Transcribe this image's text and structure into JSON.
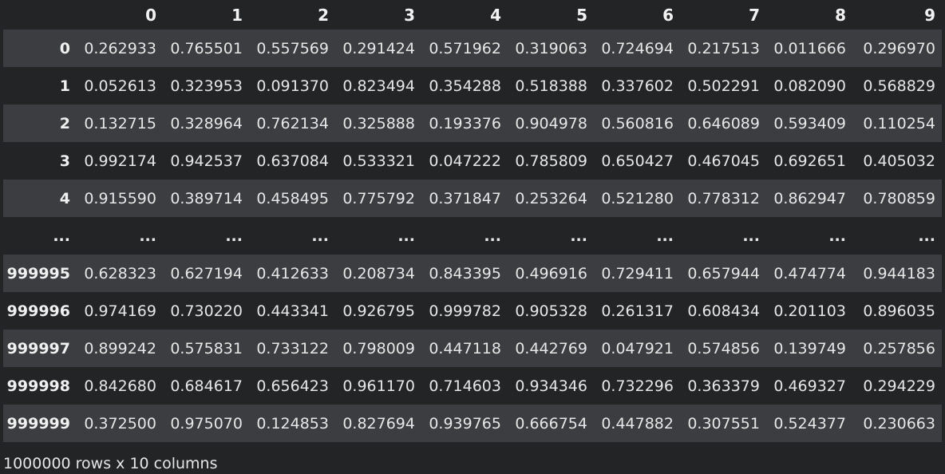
{
  "table": {
    "columns": [
      "0",
      "1",
      "2",
      "3",
      "4",
      "5",
      "6",
      "7",
      "8",
      "9"
    ],
    "rows": [
      {
        "index": "0",
        "cells": [
          "0.262933",
          "0.765501",
          "0.557569",
          "0.291424",
          "0.571962",
          "0.319063",
          "0.724694",
          "0.217513",
          "0.011666",
          "0.296970"
        ]
      },
      {
        "index": "1",
        "cells": [
          "0.052613",
          "0.323953",
          "0.091370",
          "0.823494",
          "0.354288",
          "0.518388",
          "0.337602",
          "0.502291",
          "0.082090",
          "0.568829"
        ]
      },
      {
        "index": "2",
        "cells": [
          "0.132715",
          "0.328964",
          "0.762134",
          "0.325888",
          "0.193376",
          "0.904978",
          "0.560816",
          "0.646089",
          "0.593409",
          "0.110254"
        ]
      },
      {
        "index": "3",
        "cells": [
          "0.992174",
          "0.942537",
          "0.637084",
          "0.533321",
          "0.047222",
          "0.785809",
          "0.650427",
          "0.467045",
          "0.692651",
          "0.405032"
        ]
      },
      {
        "index": "4",
        "cells": [
          "0.915590",
          "0.389714",
          "0.458495",
          "0.775792",
          "0.371847",
          "0.253264",
          "0.521280",
          "0.778312",
          "0.862947",
          "0.780859"
        ]
      },
      {
        "index": "...",
        "cells": [
          "...",
          "...",
          "...",
          "...",
          "...",
          "...",
          "...",
          "...",
          "...",
          "..."
        ]
      },
      {
        "index": "999995",
        "cells": [
          "0.628323",
          "0.627194",
          "0.412633",
          "0.208734",
          "0.843395",
          "0.496916",
          "0.729411",
          "0.657944",
          "0.474774",
          "0.944183"
        ]
      },
      {
        "index": "999996",
        "cells": [
          "0.974169",
          "0.730220",
          "0.443341",
          "0.926795",
          "0.999782",
          "0.905328",
          "0.261317",
          "0.608434",
          "0.201103",
          "0.896035"
        ]
      },
      {
        "index": "999997",
        "cells": [
          "0.899242",
          "0.575831",
          "0.733122",
          "0.798009",
          "0.447118",
          "0.442769",
          "0.047921",
          "0.574856",
          "0.139749",
          "0.257856"
        ]
      },
      {
        "index": "999998",
        "cells": [
          "0.842680",
          "0.684617",
          "0.656423",
          "0.961170",
          "0.714603",
          "0.934346",
          "0.732296",
          "0.363379",
          "0.469327",
          "0.294229"
        ]
      },
      {
        "index": "999999",
        "cells": [
          "0.372500",
          "0.975070",
          "0.124853",
          "0.827694",
          "0.939765",
          "0.666754",
          "0.447882",
          "0.307551",
          "0.524377",
          "0.230663"
        ]
      }
    ]
  },
  "footer": {
    "shape_text": "1000000 rows x 10 columns"
  },
  "colors": {
    "background": "#232426",
    "stripe_row": "#3c3d40",
    "text": "#e6e6e6"
  }
}
